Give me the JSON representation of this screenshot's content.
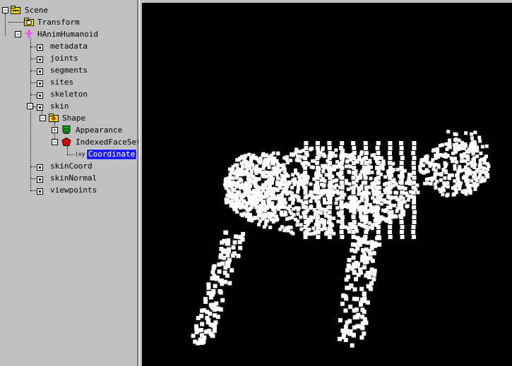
{
  "tree": {
    "nodes": [
      {
        "key": "scene",
        "label": "Scene",
        "expander": "−",
        "icon": "scene-icon"
      },
      {
        "key": "transform",
        "label": "Transform",
        "expander": "",
        "icon": "transform-icon"
      },
      {
        "key": "hanim",
        "label": "HAnimHumanoid",
        "expander": "−",
        "icon": "humanoid-icon"
      },
      {
        "key": "metadata",
        "label": "metadata",
        "expander": "",
        "icon": "field-icon"
      },
      {
        "key": "joints",
        "label": "joints",
        "expander": "",
        "icon": "field-icon"
      },
      {
        "key": "segments",
        "label": "segments",
        "expander": "",
        "icon": "field-icon"
      },
      {
        "key": "sites",
        "label": "sites",
        "expander": "",
        "icon": "field-icon"
      },
      {
        "key": "skeleton",
        "label": "skeleton",
        "expander": "",
        "icon": "field-icon"
      },
      {
        "key": "skin",
        "label": "skin",
        "expander": "−",
        "icon": "field-icon"
      },
      {
        "key": "shape",
        "label": "Shape",
        "expander": "−",
        "icon": "shape-icon"
      },
      {
        "key": "appearance",
        "label": "Appearance",
        "expander": "+",
        "icon": "appearance-icon"
      },
      {
        "key": "ifs",
        "label": "IndexedFaceSet",
        "expander": "−",
        "icon": "indexedfaceset-icon"
      },
      {
        "key": "coordinate",
        "label": "Coordinate",
        "expander": "",
        "icon": "coordinate-icon",
        "selected": true
      },
      {
        "key": "skincoord",
        "label": "skinCoord",
        "expander": "",
        "icon": "field-icon"
      },
      {
        "key": "skinnormal",
        "label": "skinNormal",
        "expander": "",
        "icon": "field-icon"
      },
      {
        "key": "viewpoints",
        "label": "viewpoints",
        "expander": "",
        "icon": "field-icon"
      }
    ]
  },
  "colors": {
    "panel_bg": "#c0c0c0",
    "viewport_bg": "#000000",
    "selection": "#2020ff",
    "points": "#ffffff",
    "scene_icon": "#ffe000",
    "humanoid_icon": "#ff40ff",
    "appearance_icon": "#00b000",
    "indexedfaceset_icon": "#e00000"
  }
}
